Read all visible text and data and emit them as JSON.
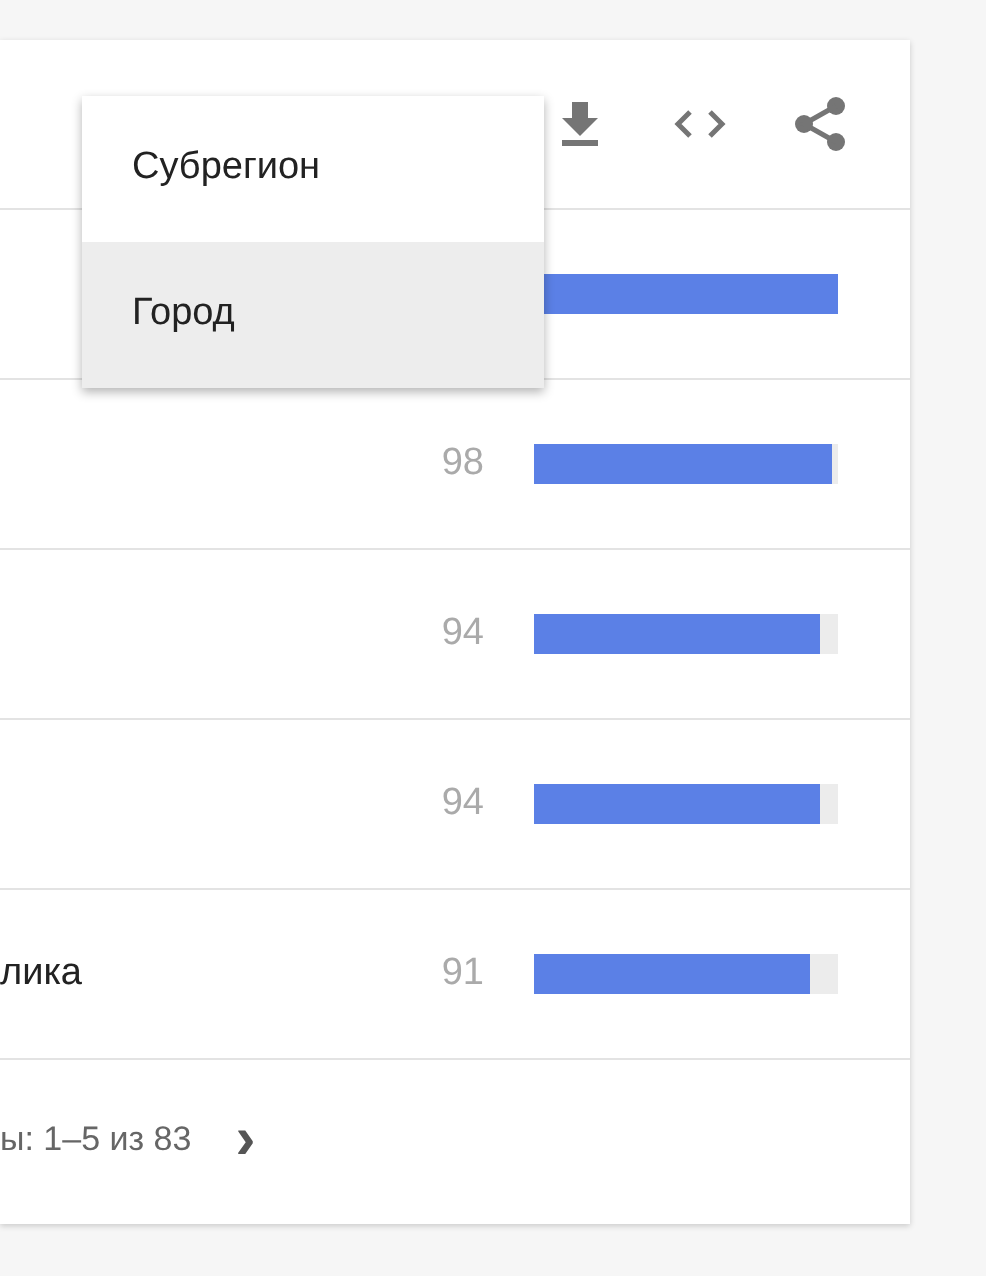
{
  "rows": [
    {
      "level": 1.0
    },
    {
      "value": "98",
      "level": 0.98
    },
    {
      "value": "94",
      "level": 0.94
    },
    {
      "value": "94",
      "level": 0.94
    },
    {
      "label": "лика",
      "value": "91",
      "level": 0.91
    }
  ],
  "footer": {
    "text": "ы: 1–5 из 83",
    "next": "›"
  },
  "menu": [
    {
      "label": "Субрегион",
      "selected": false
    },
    {
      "label": "Город",
      "selected": true
    }
  ]
}
